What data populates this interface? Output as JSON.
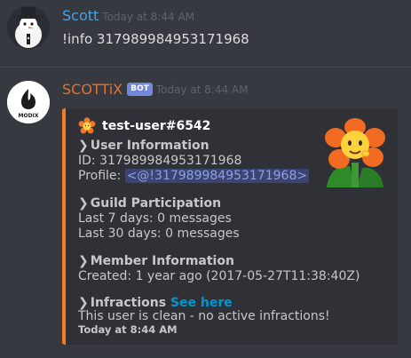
{
  "messages": [
    {
      "author": "Scott",
      "timestamp": "Today at 8:44 AM",
      "content": "!info 317989984953171968",
      "avatar_icon": "snowman-avatar-icon"
    },
    {
      "author": "SCOTTiX",
      "badge": "BOT",
      "timestamp": "Today at 8:44 AM",
      "avatar_icon": "bot-logo-icon",
      "avatar_label": "MODIX",
      "embed": {
        "accent_color": "#f47d22",
        "author_icon": "flower-icon",
        "author_name": "test-user#6542",
        "thumbnail_icon": "flower-thumbnail-icon",
        "chevron": "❯",
        "fields": {
          "user_info": {
            "name": "User Information",
            "id_line": "ID: 317989984953171968",
            "profile_label": "Profile: ",
            "profile_mention": "<@!317989984953171968>"
          },
          "guild": {
            "name": "Guild Participation",
            "last7": "Last 7 days: 0 messages",
            "last30": "Last 30 days: 0 messages"
          },
          "member": {
            "name": "Member Information",
            "created": "Created: 1 year ago (2017-05-27T11:38:40Z)"
          },
          "infractions": {
            "name": "Infractions",
            "link": "See here",
            "status": "This user is clean - no active infractions!"
          }
        },
        "footer": "Today at 8:44 AM"
      }
    }
  ]
}
